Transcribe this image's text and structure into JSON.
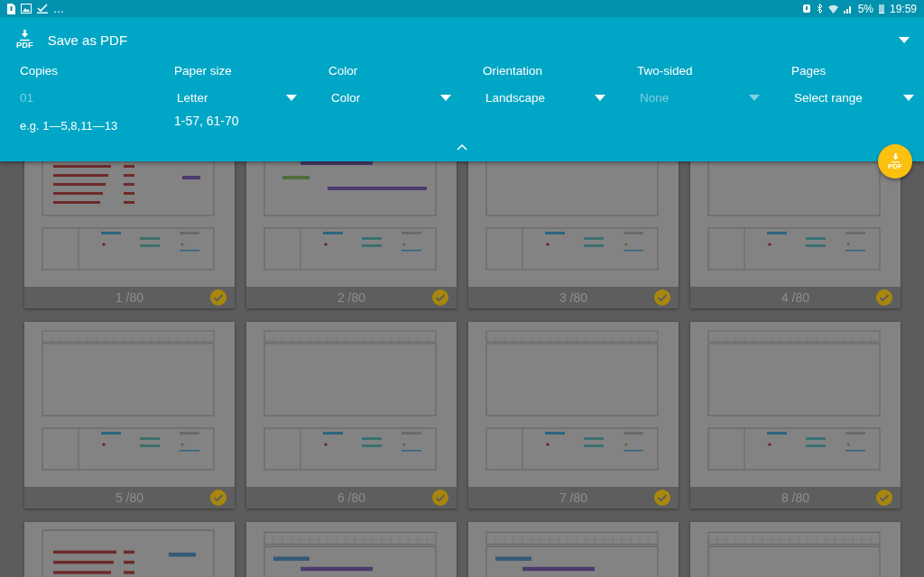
{
  "status_bar": {
    "more": "…",
    "battery": "5%",
    "time": "19:59"
  },
  "header": {
    "icon_text": "PDF",
    "title": "Save as PDF"
  },
  "fab": {
    "icon_text": "PDF"
  },
  "options": [
    {
      "label": "Copies",
      "kind": "input",
      "placeholder": "01"
    },
    {
      "label": "Paper size",
      "kind": "dropdown",
      "value": "Letter",
      "disabled": false
    },
    {
      "label": "Color",
      "kind": "dropdown",
      "value": "Color",
      "disabled": false
    },
    {
      "label": "Orientation",
      "kind": "dropdown",
      "value": "Landscape",
      "disabled": false
    },
    {
      "label": "Two-sided",
      "kind": "dropdown",
      "value": "None",
      "disabled": true
    },
    {
      "label": "Pages",
      "kind": "dropdown",
      "value": "Select range",
      "disabled": false
    }
  ],
  "page_range": {
    "hint": "e.g. 1—5,8,11—13",
    "value": "1-57, 61-70"
  },
  "pages": [
    {
      "kind": "tasks",
      "label": "1 /80",
      "selected": true
    },
    {
      "kind": "bars",
      "label": "2 /80",
      "selected": true
    },
    {
      "kind": "blank",
      "label": "3 /80",
      "selected": true
    },
    {
      "kind": "blank",
      "label": "4 /80",
      "selected": true
    },
    {
      "kind": "timescale",
      "label": "5 /80",
      "selected": true
    },
    {
      "kind": "timescale",
      "label": "6 /80",
      "selected": true
    },
    {
      "kind": "timescale",
      "label": "7 /80",
      "selected": true
    },
    {
      "kind": "timescale",
      "label": "8 /80",
      "selected": true
    },
    {
      "kind": "tasks"
    },
    {
      "kind": "gantt"
    },
    {
      "kind": "gantt"
    },
    {
      "kind": "timescale"
    }
  ]
}
